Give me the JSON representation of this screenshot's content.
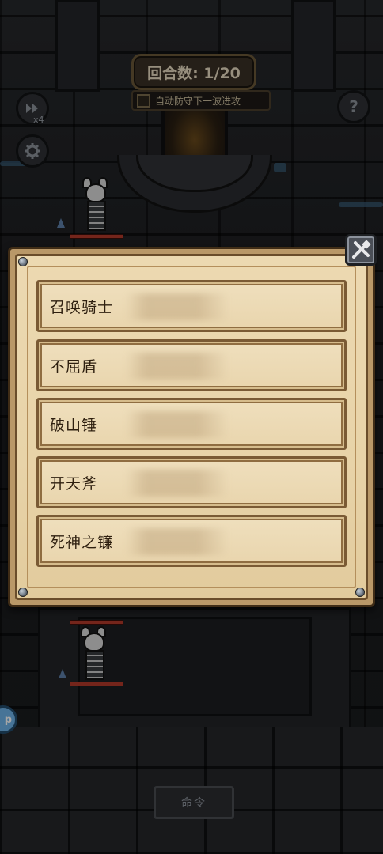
{
  "hud": {
    "round_label": "回合数: 1/20",
    "auto_defend_label": "自动防守下一波进攻",
    "auto_defend_checked": false,
    "speed_multiplier": "x4",
    "help_symbol": "?",
    "side_badge_text": "p",
    "command_label": "命令"
  },
  "icons": {
    "fast_forward": "fast-forward-icon",
    "settings": "gear-icon",
    "help": "question-mark-icon",
    "close": "crossed-swords-icon"
  },
  "skill_panel": {
    "items": [
      {
        "label": "召唤骑士"
      },
      {
        "label": "不屈盾"
      },
      {
        "label": "破山锤"
      },
      {
        "label": "开天斧"
      },
      {
        "label": "死神之镰"
      }
    ]
  },
  "colors": {
    "parchment": "#e8d3a8",
    "panel_border": "#6a4d2b",
    "hp_bar": "#b33a2a",
    "round_badge": "#3a3026"
  }
}
